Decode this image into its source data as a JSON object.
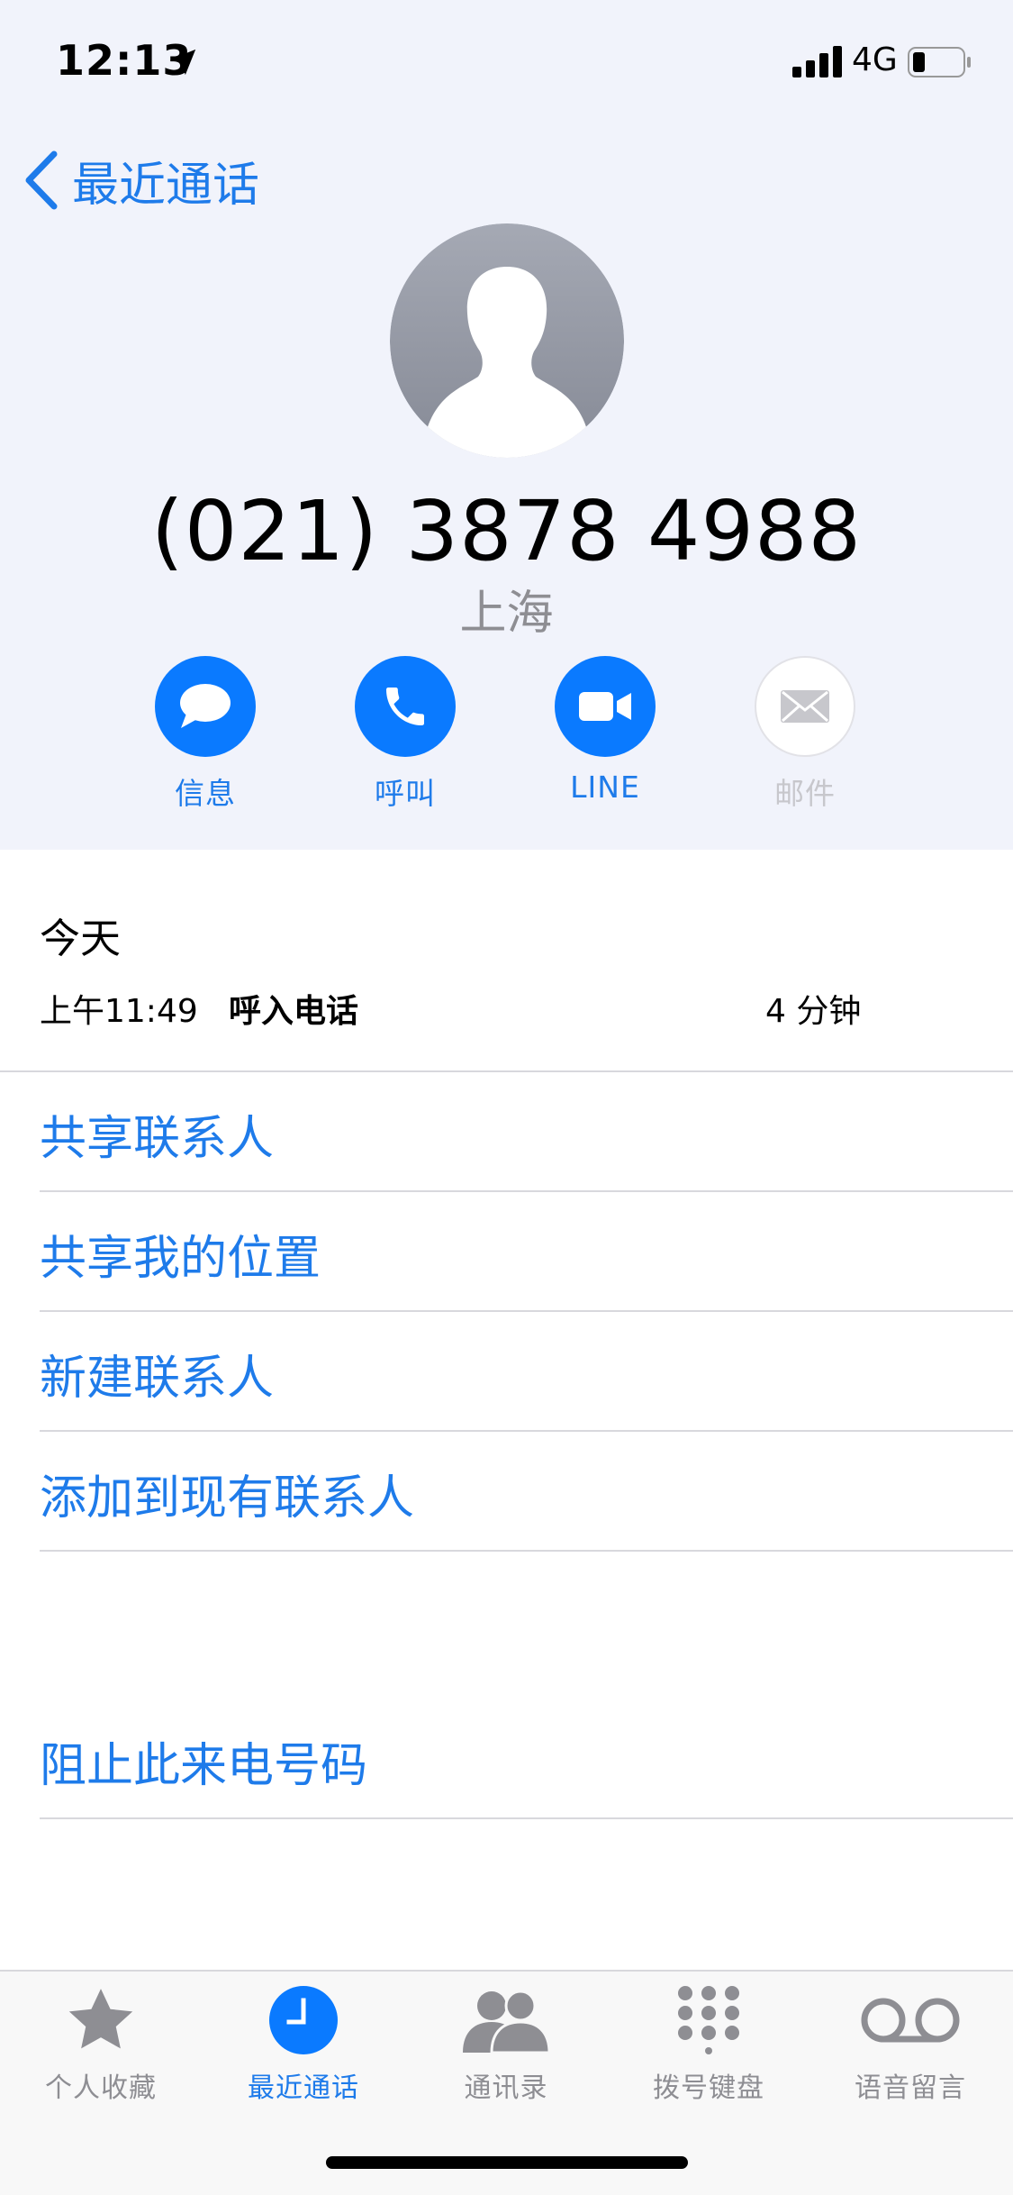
{
  "status_bar": {
    "time": "12:13",
    "network": "4G"
  },
  "nav": {
    "back_label": "最近通话"
  },
  "contact": {
    "phone": "(021) 3878 4988",
    "location": "上海"
  },
  "actions": [
    {
      "label": "信息",
      "icon": "message-icon"
    },
    {
      "label": "呼叫",
      "icon": "phone-icon"
    },
    {
      "label": "LINE",
      "icon": "video-icon"
    },
    {
      "label": "邮件",
      "icon": "mail-icon"
    }
  ],
  "recents": {
    "day": "今天",
    "call": {
      "time": "上午11:49",
      "type": "呼入电话",
      "duration": "4 分钟"
    }
  },
  "options": [
    "共享联系人",
    "共享我的位置",
    "新建联系人",
    "添加到现有联系人"
  ],
  "block": "阻止此来电号码",
  "tabs": [
    {
      "label": "个人收藏",
      "icon": "star-icon"
    },
    {
      "label": "最近通话",
      "icon": "clock-icon",
      "active": true
    },
    {
      "label": "通讯录",
      "icon": "contacts-icon"
    },
    {
      "label": "拨号键盘",
      "icon": "keypad-icon"
    },
    {
      "label": "语音留言",
      "icon": "voicemail-icon"
    }
  ],
  "colors": {
    "accent": "#1e7bea",
    "header_bg": "#f1f3fb",
    "secondary_text": "#8e8e93"
  }
}
